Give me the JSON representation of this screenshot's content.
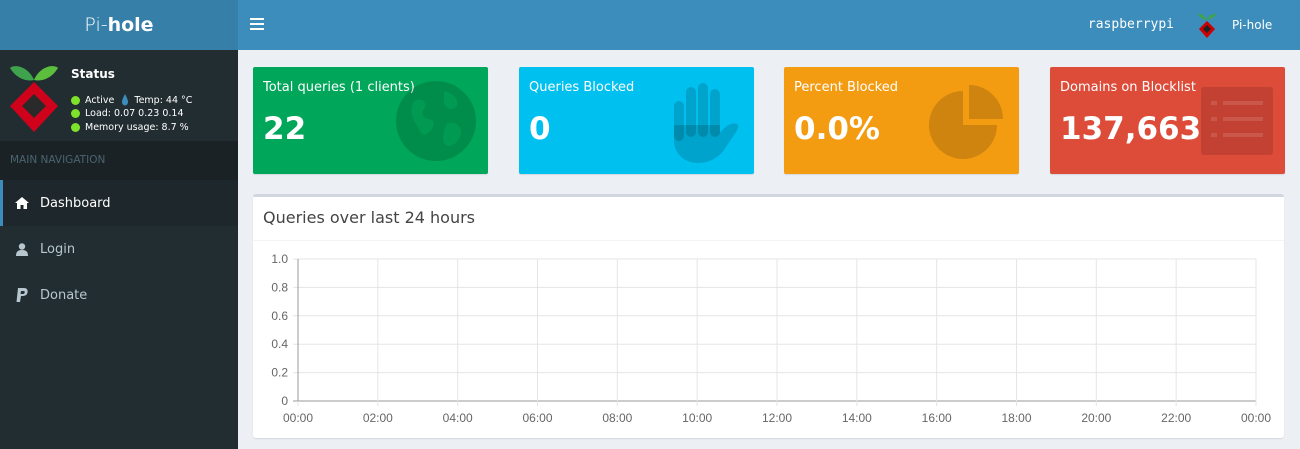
{
  "app": {
    "logo_light": "Pi-",
    "logo_bold": "hole",
    "hostname": "raspberrypi",
    "user_name": "Pi-hole"
  },
  "sidebar": {
    "status_title": "Status",
    "active_label": "Active",
    "temp_label": "Temp: 44 °C",
    "load_label": "Load:  0.07  0.23  0.14",
    "memory_label": "Memory usage:  8.7 %",
    "nav_header": "MAIN NAVIGATION",
    "items": [
      {
        "label": "Dashboard",
        "icon": "home-icon",
        "active": true
      },
      {
        "label": "Login",
        "icon": "user-icon",
        "active": false
      },
      {
        "label": "Donate",
        "icon": "paypal-icon",
        "active": false
      }
    ]
  },
  "stats": [
    {
      "label": "Total queries (1 clients)",
      "value": "22",
      "icon": "globe-icon",
      "color": "#00a65a"
    },
    {
      "label": "Queries Blocked",
      "value": "0",
      "icon": "hand-icon",
      "color": "#00c0ef"
    },
    {
      "label": "Percent Blocked",
      "value": "0.0%",
      "icon": "pie-chart-icon",
      "color": "#f39c12"
    },
    {
      "label": "Domains on Blocklist",
      "value": "137,663",
      "icon": "list-icon",
      "color": "#dd4b39"
    }
  ],
  "chart": {
    "title": "Queries over last 24 hours"
  },
  "chart_data": {
    "type": "line",
    "title": "Queries over last 24 hours",
    "xlabel": "",
    "ylabel": "",
    "x_ticks": [
      "00:00",
      "02:00",
      "04:00",
      "06:00",
      "08:00",
      "10:00",
      "12:00",
      "14:00",
      "16:00",
      "18:00",
      "20:00",
      "22:00",
      "00:00"
    ],
    "y_ticks": [
      "1.0",
      "0.8",
      "0.6",
      "0.4",
      "0.2",
      "0"
    ],
    "ylim": [
      0,
      1
    ],
    "grid": true,
    "series": []
  }
}
